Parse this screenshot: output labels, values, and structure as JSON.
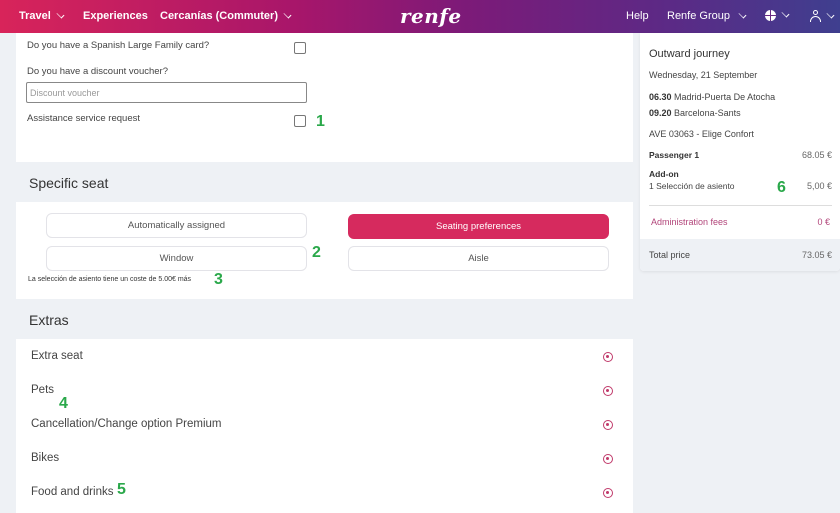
{
  "topbar": {
    "nav": [
      {
        "label": "Travel",
        "has_dropdown": true
      },
      {
        "label": "Experiences",
        "has_dropdown": false
      },
      {
        "label": "Cercanías (Commuter)",
        "has_dropdown": true
      }
    ],
    "logo": "renfe",
    "help": "Help",
    "group": "Renfe Group",
    "language_icon": "globe-icon",
    "user_icon": "user-icon"
  },
  "discounts": {
    "large_family_label": "Do you have a Spanish Large Family card?",
    "voucher_label": "Do you have a discount voucher?",
    "voucher_placeholder": "Discount voucher",
    "voucher_value": "",
    "assistance_label": "Assistance service request",
    "large_family_checked": false,
    "assistance_checked": false
  },
  "seat": {
    "heading": "Specific seat",
    "options": [
      {
        "label": "Automatically assigned",
        "selected": false
      },
      {
        "label": "Seating preferences",
        "selected": true
      },
      {
        "label": "Window",
        "selected": false
      },
      {
        "label": "Aisle",
        "selected": false
      }
    ],
    "note": "La selección de asiento tiene un coste de 5.00€ más"
  },
  "extras": {
    "heading": "Extras",
    "items": [
      {
        "label": "Extra seat",
        "icon": "add-circle-icon"
      },
      {
        "label": "Pets",
        "icon": "add-circle-icon"
      },
      {
        "label": "Cancellation/Change option Premium",
        "icon": "add-circle-icon"
      },
      {
        "label": "Bikes",
        "icon": "add-circle-icon"
      },
      {
        "label": "Food and drinks",
        "icon": "add-circle-icon"
      }
    ]
  },
  "annotations": [
    "1",
    "2",
    "3",
    "4",
    "5",
    "6"
  ],
  "summary": {
    "title": "Outward journey",
    "date": "Wednesday, 21 September",
    "departure_time": "06.30",
    "departure_station": "Madrid-Puerta De Atocha",
    "arrival_time": "09.20",
    "arrival_station": "Barcelona-Sants",
    "train": "AVE 03063 - Elige Confort",
    "passenger_label": "Passenger 1",
    "passenger_price": "68.05 €",
    "addon_label": "Add-on",
    "addon_item": "1 Selección de asiento",
    "addon_price": "5,00 €",
    "fees_label": "Administration fees",
    "fees_price": "0 €",
    "total_label": "Total price",
    "total_price": "73.05 €"
  },
  "colors": {
    "accent": "#d62a5e",
    "annotation": "#2aa84a",
    "fees": "#b2457a"
  }
}
